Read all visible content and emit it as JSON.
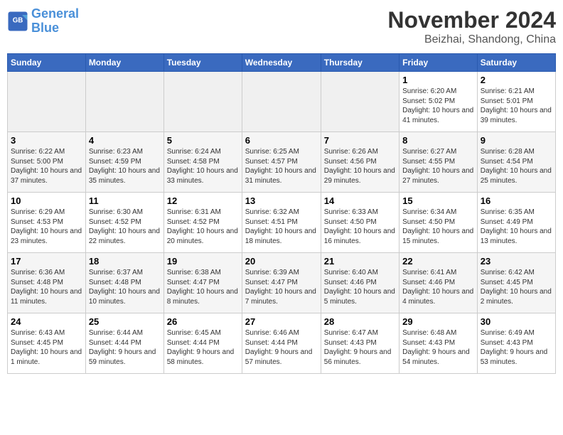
{
  "header": {
    "logo_line1": "General",
    "logo_line2": "Blue",
    "month_title": "November 2024",
    "location": "Beizhai, Shandong, China"
  },
  "weekdays": [
    "Sunday",
    "Monday",
    "Tuesday",
    "Wednesday",
    "Thursday",
    "Friday",
    "Saturday"
  ],
  "weeks": [
    [
      {
        "day": "",
        "info": ""
      },
      {
        "day": "",
        "info": ""
      },
      {
        "day": "",
        "info": ""
      },
      {
        "day": "",
        "info": ""
      },
      {
        "day": "",
        "info": ""
      },
      {
        "day": "1",
        "info": "Sunrise: 6:20 AM\nSunset: 5:02 PM\nDaylight: 10 hours and 41 minutes."
      },
      {
        "day": "2",
        "info": "Sunrise: 6:21 AM\nSunset: 5:01 PM\nDaylight: 10 hours and 39 minutes."
      }
    ],
    [
      {
        "day": "3",
        "info": "Sunrise: 6:22 AM\nSunset: 5:00 PM\nDaylight: 10 hours and 37 minutes."
      },
      {
        "day": "4",
        "info": "Sunrise: 6:23 AM\nSunset: 4:59 PM\nDaylight: 10 hours and 35 minutes."
      },
      {
        "day": "5",
        "info": "Sunrise: 6:24 AM\nSunset: 4:58 PM\nDaylight: 10 hours and 33 minutes."
      },
      {
        "day": "6",
        "info": "Sunrise: 6:25 AM\nSunset: 4:57 PM\nDaylight: 10 hours and 31 minutes."
      },
      {
        "day": "7",
        "info": "Sunrise: 6:26 AM\nSunset: 4:56 PM\nDaylight: 10 hours and 29 minutes."
      },
      {
        "day": "8",
        "info": "Sunrise: 6:27 AM\nSunset: 4:55 PM\nDaylight: 10 hours and 27 minutes."
      },
      {
        "day": "9",
        "info": "Sunrise: 6:28 AM\nSunset: 4:54 PM\nDaylight: 10 hours and 25 minutes."
      }
    ],
    [
      {
        "day": "10",
        "info": "Sunrise: 6:29 AM\nSunset: 4:53 PM\nDaylight: 10 hours and 23 minutes."
      },
      {
        "day": "11",
        "info": "Sunrise: 6:30 AM\nSunset: 4:52 PM\nDaylight: 10 hours and 22 minutes."
      },
      {
        "day": "12",
        "info": "Sunrise: 6:31 AM\nSunset: 4:52 PM\nDaylight: 10 hours and 20 minutes."
      },
      {
        "day": "13",
        "info": "Sunrise: 6:32 AM\nSunset: 4:51 PM\nDaylight: 10 hours and 18 minutes."
      },
      {
        "day": "14",
        "info": "Sunrise: 6:33 AM\nSunset: 4:50 PM\nDaylight: 10 hours and 16 minutes."
      },
      {
        "day": "15",
        "info": "Sunrise: 6:34 AM\nSunset: 4:50 PM\nDaylight: 10 hours and 15 minutes."
      },
      {
        "day": "16",
        "info": "Sunrise: 6:35 AM\nSunset: 4:49 PM\nDaylight: 10 hours and 13 minutes."
      }
    ],
    [
      {
        "day": "17",
        "info": "Sunrise: 6:36 AM\nSunset: 4:48 PM\nDaylight: 10 hours and 11 minutes."
      },
      {
        "day": "18",
        "info": "Sunrise: 6:37 AM\nSunset: 4:48 PM\nDaylight: 10 hours and 10 minutes."
      },
      {
        "day": "19",
        "info": "Sunrise: 6:38 AM\nSunset: 4:47 PM\nDaylight: 10 hours and 8 minutes."
      },
      {
        "day": "20",
        "info": "Sunrise: 6:39 AM\nSunset: 4:47 PM\nDaylight: 10 hours and 7 minutes."
      },
      {
        "day": "21",
        "info": "Sunrise: 6:40 AM\nSunset: 4:46 PM\nDaylight: 10 hours and 5 minutes."
      },
      {
        "day": "22",
        "info": "Sunrise: 6:41 AM\nSunset: 4:46 PM\nDaylight: 10 hours and 4 minutes."
      },
      {
        "day": "23",
        "info": "Sunrise: 6:42 AM\nSunset: 4:45 PM\nDaylight: 10 hours and 2 minutes."
      }
    ],
    [
      {
        "day": "24",
        "info": "Sunrise: 6:43 AM\nSunset: 4:45 PM\nDaylight: 10 hours and 1 minute."
      },
      {
        "day": "25",
        "info": "Sunrise: 6:44 AM\nSunset: 4:44 PM\nDaylight: 9 hours and 59 minutes."
      },
      {
        "day": "26",
        "info": "Sunrise: 6:45 AM\nSunset: 4:44 PM\nDaylight: 9 hours and 58 minutes."
      },
      {
        "day": "27",
        "info": "Sunrise: 6:46 AM\nSunset: 4:44 PM\nDaylight: 9 hours and 57 minutes."
      },
      {
        "day": "28",
        "info": "Sunrise: 6:47 AM\nSunset: 4:43 PM\nDaylight: 9 hours and 56 minutes."
      },
      {
        "day": "29",
        "info": "Sunrise: 6:48 AM\nSunset: 4:43 PM\nDaylight: 9 hours and 54 minutes."
      },
      {
        "day": "30",
        "info": "Sunrise: 6:49 AM\nSunset: 4:43 PM\nDaylight: 9 hours and 53 minutes."
      }
    ]
  ]
}
